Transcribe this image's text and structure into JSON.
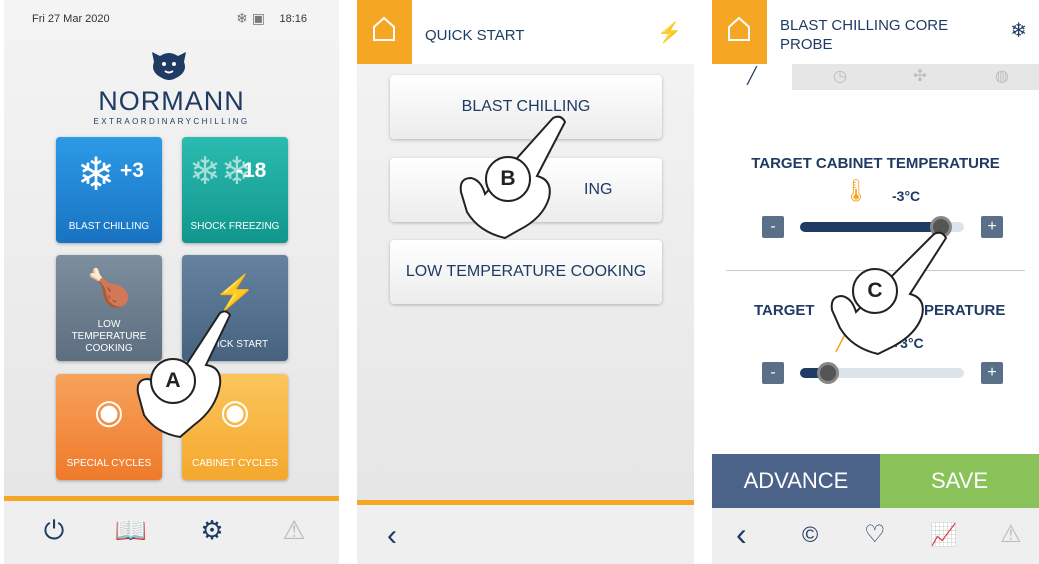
{
  "home": {
    "date": "Fri 27 Mar 2020",
    "time": "18:16",
    "brand": "NORMANN",
    "tagline": "EXTRAORDINARYCHILLING",
    "tiles": [
      {
        "label": "BLAST CHILLING",
        "value": "+3",
        "color": "#1e88d6"
      },
      {
        "label": "SHOCK FREEZING",
        "value": "-18",
        "color": "#17a59a"
      },
      {
        "label": "LOW TEMPERATURE COOKING",
        "color": "#6f8191"
      },
      {
        "label": "QUICK START",
        "color": "#55728f"
      },
      {
        "label": "SPECIAL CYCLES",
        "color": "#f2873a"
      },
      {
        "label": "CABINET CYCLES",
        "color": "#f7b441"
      }
    ],
    "nav": [
      "power-icon",
      "book-icon",
      "gears-icon",
      "alert-icon"
    ]
  },
  "quick_start": {
    "title": "QUICK START",
    "options": [
      "BLAST CHILLING",
      "SHOCK FREEZING",
      "LOW TEMPERATURE COOKING"
    ],
    "visible_partial": [
      "S",
      "ING"
    ]
  },
  "core_probe": {
    "title": "BLAST CHILLING CORE PROBE",
    "cabinet": {
      "title": "TARGET CABINET TEMPERATURE",
      "value": "-3°C",
      "fill": 0.86
    },
    "probe": {
      "title_left": "TARGET",
      "title_right": "PERATURE",
      "value": "+3°C",
      "fill": 0.17
    },
    "advance_label": "ADVANCE",
    "save_label": "SAVE"
  },
  "badges": {
    "a": "A",
    "b": "B",
    "c": "C"
  },
  "colors": {
    "accent": "#f5a623",
    "navy": "#1f3b63",
    "advance": "#4b6389",
    "save": "#8ac25a"
  }
}
